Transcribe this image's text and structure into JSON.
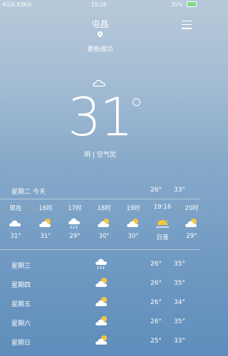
{
  "status_bar": {
    "left": "4G|0.93K/s",
    "time": "15:26",
    "battery": "35%"
  },
  "header": {
    "city": "屯昌",
    "update_status": "更新成功"
  },
  "current": {
    "temperature": "31",
    "condition": "阴 | 空气优"
  },
  "today": {
    "label": "星期二 今天",
    "low": "26°",
    "high": "33°"
  },
  "hourly": [
    {
      "time": "现在",
      "icon": "cloud-icon",
      "temp": "31°"
    },
    {
      "time": "16时",
      "icon": "partly-cloudy-icon",
      "temp": "31°"
    },
    {
      "time": "17时",
      "icon": "rain-cloud-icon",
      "temp": "29°"
    },
    {
      "time": "18时",
      "icon": "partly-cloudy-icon",
      "temp": "30°"
    },
    {
      "time": "19时",
      "icon": "partly-cloudy-icon",
      "temp": "30°"
    },
    {
      "time": "19:16",
      "icon": "sunset-icon",
      "temp": "日落"
    },
    {
      "time": "20时",
      "icon": "partly-cloudy-icon",
      "temp": "29°"
    }
  ],
  "daily": [
    {
      "day": "星期三",
      "icon": "rain-cloud-icon",
      "low": "26°",
      "high": "35°"
    },
    {
      "day": "星期四",
      "icon": "partly-cloudy-icon",
      "low": "26°",
      "high": "35°"
    },
    {
      "day": "星期五",
      "icon": "partly-cloudy-icon",
      "low": "26°",
      "high": "34°"
    },
    {
      "day": "星期六",
      "icon": "partly-cloudy-icon",
      "low": "26°",
      "high": "35°"
    },
    {
      "day": "星期日",
      "icon": "partly-cloudy-icon",
      "low": "25°",
      "high": "33°"
    }
  ]
}
